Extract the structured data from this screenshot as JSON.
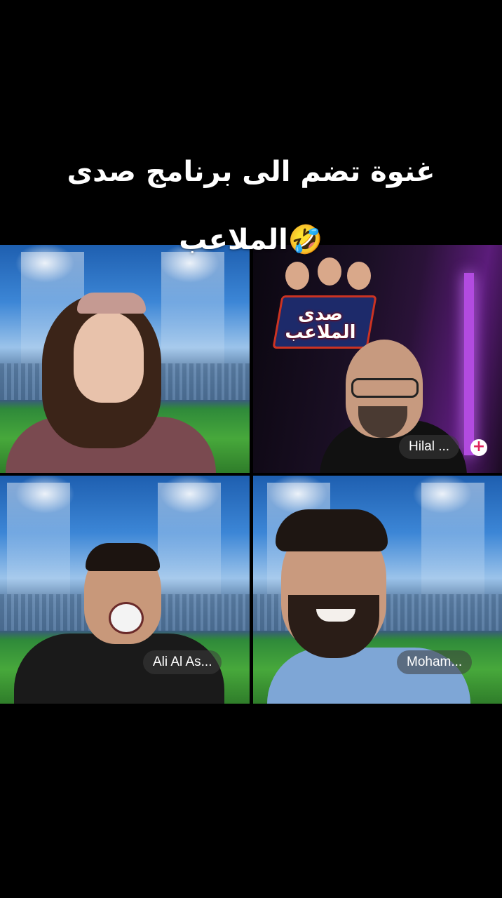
{
  "caption": {
    "line1": "غنوة تضم الى برنامج صدى",
    "line2": "الملاعب",
    "emoji": "🤣"
  },
  "tiles": [
    {
      "id": "host",
      "name": ""
    },
    {
      "id": "hilal",
      "name": "Hilal ...",
      "action_icon": "+"
    },
    {
      "id": "ali",
      "name": "Ali Al As..."
    },
    {
      "id": "mohammed",
      "name": "Moham..."
    }
  ],
  "logo": {
    "text": "صدى الملاعب"
  },
  "colors": {
    "background": "#000000",
    "neon": "#b24be0",
    "plus": "#e0245e"
  }
}
